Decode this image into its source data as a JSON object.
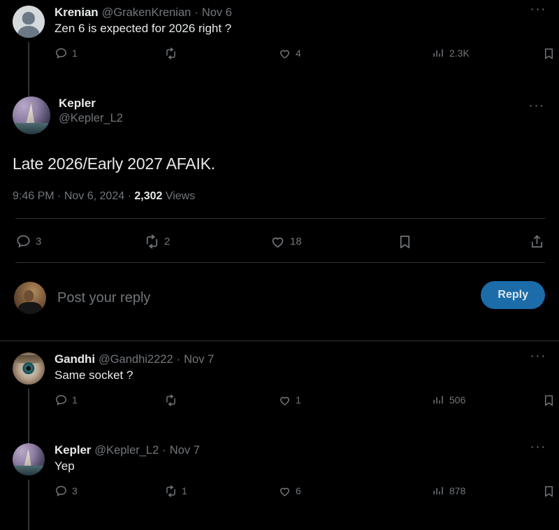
{
  "thread": {
    "parent_post": {
      "author_name": "Krenian",
      "author_handle": "@GrakenKrenian",
      "separator": "·",
      "date": "Nov 6",
      "text": "Zen 6 is expected for 2026 right ?",
      "avatar": "default-person-avatar",
      "more_label": "···",
      "actions": {
        "reply_count": "1",
        "repost_count": "",
        "like_count": "4",
        "views_count": "2.3K",
        "bookmark_label": "",
        "share_label": ""
      }
    },
    "focused_post": {
      "author_name": "Kepler",
      "author_handle": "@Kepler_L2",
      "text": "Late 2026/Early 2027 AFAIK.",
      "avatar": "kepler-sailboat-avatar",
      "more_label": "···",
      "timestamp_time": "9:46 PM",
      "timestamp_sep1": "·",
      "timestamp_date": "Nov 6, 2024",
      "timestamp_sep2": "·",
      "views_number": "2,302",
      "views_label": "Views",
      "actions": {
        "reply_count": "3",
        "repost_count": "2",
        "like_count": "18",
        "bookmark_label": "",
        "share_label": ""
      }
    },
    "composer": {
      "placeholder": "Post your reply",
      "reply_button_label": "Reply",
      "avatar": "current-user-avatar"
    },
    "replies": [
      {
        "author_name": "Gandhi",
        "author_handle": "@Gandhi2222",
        "separator": "·",
        "date": "Nov 7",
        "text": "Same socket ?",
        "avatar": "eye-photo-avatar",
        "more_label": "···",
        "actions": {
          "reply_count": "1",
          "repost_count": "",
          "like_count": "1",
          "views_count": "506",
          "bookmark_label": "",
          "share_label": ""
        }
      },
      {
        "author_name": "Kepler",
        "author_handle": "@Kepler_L2",
        "separator": "·",
        "date": "Nov 7",
        "text": "Yep",
        "avatar": "kepler-sailboat-avatar",
        "more_label": "···",
        "actions": {
          "reply_count": "3",
          "repost_count": "1",
          "like_count": "6",
          "views_count": "878",
          "bookmark_label": "",
          "share_label": ""
        }
      }
    ]
  },
  "colors": {
    "background": "#000000",
    "text_primary": "#e7e9ea",
    "text_secondary": "#71767b",
    "divider": "#2f3336",
    "accent_blue": "#1b6ca8"
  }
}
